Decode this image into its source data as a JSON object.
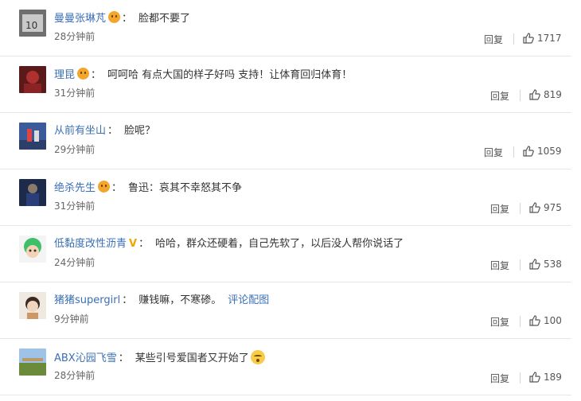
{
  "separator": "：",
  "reply_label": "回复",
  "comments": [
    {
      "user": "曼曼张琳芃",
      "badge": "face",
      "content": "脸都不要了",
      "time": "28分钟前",
      "likes": "1717"
    },
    {
      "user": "理昆",
      "badge": "face",
      "content": "呵呵哈 有点大国的样子好吗 支持！让体育回归体育！",
      "time": "31分钟前",
      "likes": "819"
    },
    {
      "user": "从前有坐山",
      "badge": "",
      "content": "脸呢？",
      "time": "29分钟前",
      "likes": "1059"
    },
    {
      "user": "绝杀先生",
      "badge": "face",
      "content": "鲁迅：哀其不幸怒其不争",
      "time": "31分钟前",
      "likes": "975"
    },
    {
      "user": "低黏度改性沥青",
      "badge": "V",
      "content": "哈哈，群众还硬着，自己先软了，以后没人帮你说话了",
      "time": "24分钟前",
      "likes": "538"
    },
    {
      "user": "猪猪supergirl",
      "badge": "",
      "content": "赚钱嘛，不寒碜。",
      "link": "评论配图",
      "time": "9分钟前",
      "likes": "100"
    },
    {
      "user": "ABX沁园飞雪",
      "badge": "",
      "content": "某些引号爱国者又开始了",
      "emoji": "smirk-emoji",
      "time": "28分钟前",
      "likes": "189"
    }
  ]
}
